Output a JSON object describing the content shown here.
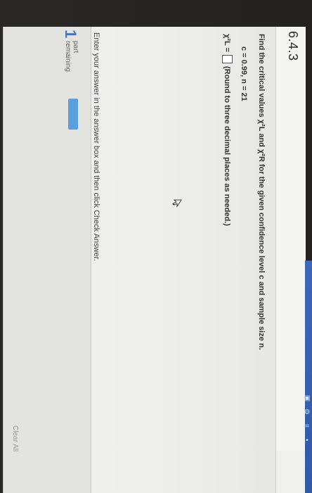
{
  "header": {
    "problem_id": "6.4.3"
  },
  "question": {
    "prompt": "Find the critical values χ²L and χ²R for the given confidence level c and sample size n.",
    "given": "c = 0.99, n = 21",
    "answer_prefix": "χ²L =",
    "answer_hint": "(Round to three decimal places as needed.)"
  },
  "instruction": {
    "text": "Enter your answer in the answer box and then click Check Answer."
  },
  "progress": {
    "count": "1",
    "label_line1": "part",
    "label_line2": "remaining"
  },
  "actions": {
    "clear_all": "Clear All"
  },
  "icons": {
    "cursor": "mouse-cursor-icon"
  },
  "colors": {
    "accent": "#3c7ad1",
    "progress_fill": "#5aa0df",
    "edge_blue": "#2f5aa6"
  }
}
